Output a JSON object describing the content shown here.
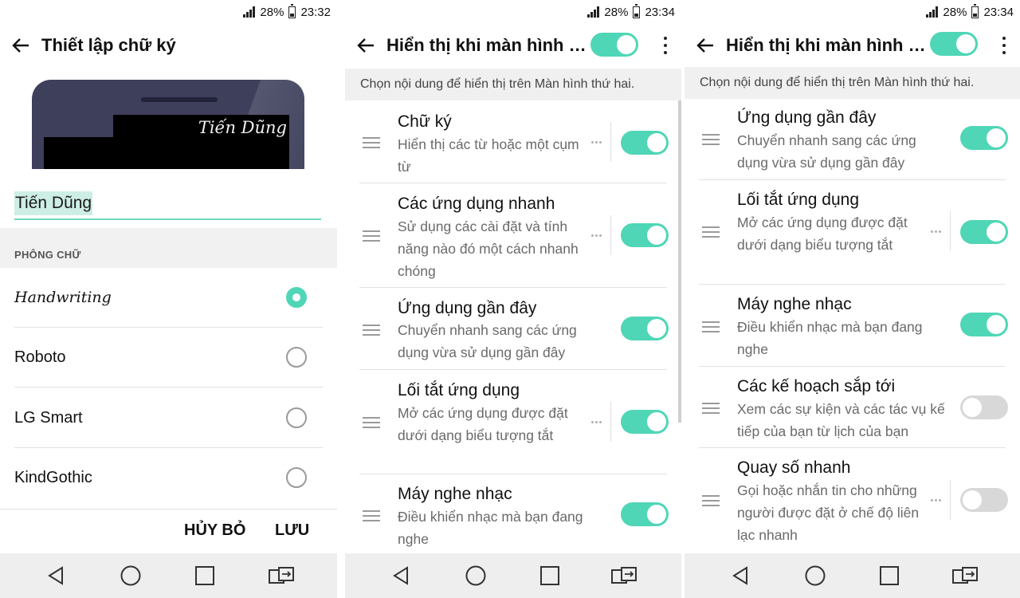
{
  "panel1": {
    "status": {
      "battery_pct": "28%",
      "time": "23:32"
    },
    "appbar": {
      "title": "Thiết lập chữ ký"
    },
    "preview": {
      "signature_text": "Tiến Dũng"
    },
    "signature_input": {
      "value": "Tiến Dũng"
    },
    "font_section": {
      "header": "PHÔNG CHỮ"
    },
    "fonts": [
      {
        "label": "Handwriting",
        "selected": true
      },
      {
        "label": "Roboto",
        "selected": false
      },
      {
        "label": "LG Smart",
        "selected": false
      },
      {
        "label": "KindGothic",
        "selected": false
      }
    ],
    "actions": {
      "cancel_label": "HỦY BỎ",
      "save_label": "LƯU"
    }
  },
  "panel2": {
    "status": {
      "battery_pct": "28%",
      "time": "23:34"
    },
    "appbar": {
      "title": "Hiển thị khi màn hình ch...",
      "master_switch_on": true
    },
    "subtitle": "Chọn nội dung để hiển thị trên Màn hình thứ hai.",
    "items": [
      {
        "title": "Chữ ký",
        "desc": "Hiển thị các từ hoặc một cụm từ",
        "on": true,
        "has_settings": true
      },
      {
        "title": "Các ứng dụng nhanh",
        "desc": "Sử dụng các cài đặt và tính năng nào đó một cách nhanh chóng",
        "on": true,
        "has_settings": true
      },
      {
        "title": "Ứng dụng gần đây",
        "desc": "Chuyển nhanh sang các ứng dụng vừa sử dụng gần đây",
        "on": true,
        "has_settings": false
      },
      {
        "title": "Lối tắt ứng dụng",
        "desc": "Mở các ứng dụng được đặt dưới dạng biểu tượng tắt",
        "on": true,
        "has_settings": true
      },
      {
        "title": "Máy nghe nhạc",
        "desc": "Điều khiển nhạc mà bạn đang nghe",
        "on": true,
        "has_settings": false
      }
    ]
  },
  "panel3": {
    "status": {
      "battery_pct": "28%",
      "time": "23:34"
    },
    "appbar": {
      "title": "Hiển thị khi màn hình ch...",
      "master_switch_on": true
    },
    "subtitle": "Chọn nội dung để hiển thị trên Màn hình thứ hai.",
    "items": [
      {
        "title": "Ứng dụng gần đây",
        "desc": "Chuyển nhanh sang các ứng dụng vừa sử dụng gần đây",
        "on": true,
        "has_settings": false
      },
      {
        "title": "Lối tắt ứng dụng",
        "desc": "Mở các ứng dụng được đặt dưới dạng biểu tượng tắt",
        "on": true,
        "has_settings": true
      },
      {
        "title": "Máy nghe nhạc",
        "desc": "Điều khiển nhạc mà bạn đang nghe",
        "on": true,
        "has_settings": false
      },
      {
        "title": "Các kế hoạch sắp tới",
        "desc": "Xem các sự kiện và các tác vụ kế tiếp của bạn từ lịch của bạn",
        "on": false,
        "has_settings": false
      },
      {
        "title": "Quay số nhanh",
        "desc": "Gọi hoặc nhắn tin cho những người được đặt ở chế độ liên lạc nhanh",
        "on": false,
        "has_settings": true
      }
    ]
  },
  "navbar": {
    "icons": [
      "back-icon",
      "home-icon",
      "recents-icon",
      "dual-window-icon"
    ]
  },
  "colors": {
    "accent": "#4fd6b6",
    "switch_off": "#d8d8d8",
    "band": "#f0f0f0",
    "navbar": "#eeeeee"
  }
}
